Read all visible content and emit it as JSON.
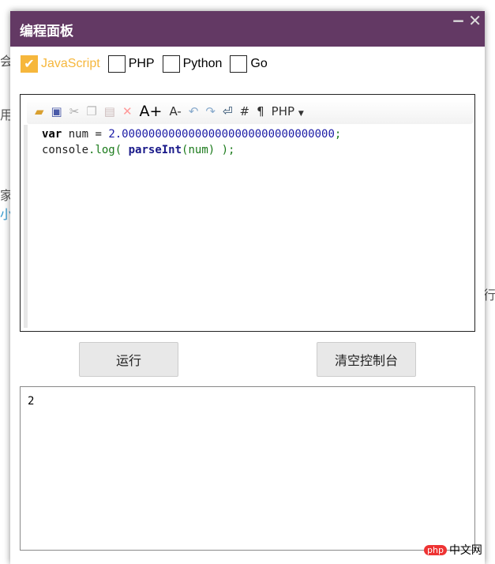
{
  "background": {
    "fragments": [
      "会",
      "用",
      "家",
      "小",
      "行"
    ]
  },
  "dialog": {
    "title": "编程面板",
    "minimize": "−",
    "close": "✕"
  },
  "languages": [
    {
      "label": "JavaScript",
      "checked": true
    },
    {
      "label": "PHP",
      "checked": false
    },
    {
      "label": "Python",
      "checked": false
    },
    {
      "label": "Go",
      "checked": false
    }
  ],
  "toolbar": {
    "hash": "#",
    "pilcrow": "¶",
    "font_up": "A+",
    "font_down": "A-",
    "language": "PHP"
  },
  "code": {
    "line1": {
      "kw": "var",
      "rest": " num = ",
      "num": "2.00000000000000000000000000000000",
      "semi": ";"
    },
    "line2": {
      "a": "console",
      "b": ".log(",
      "c": " ",
      "fn": "parseInt",
      "d": "(num)",
      "e": " );"
    }
  },
  "buttons": {
    "run": "运行",
    "clear": "清空控制台"
  },
  "output": "2",
  "watermark": {
    "logo": "php",
    "text": "中文网"
  }
}
